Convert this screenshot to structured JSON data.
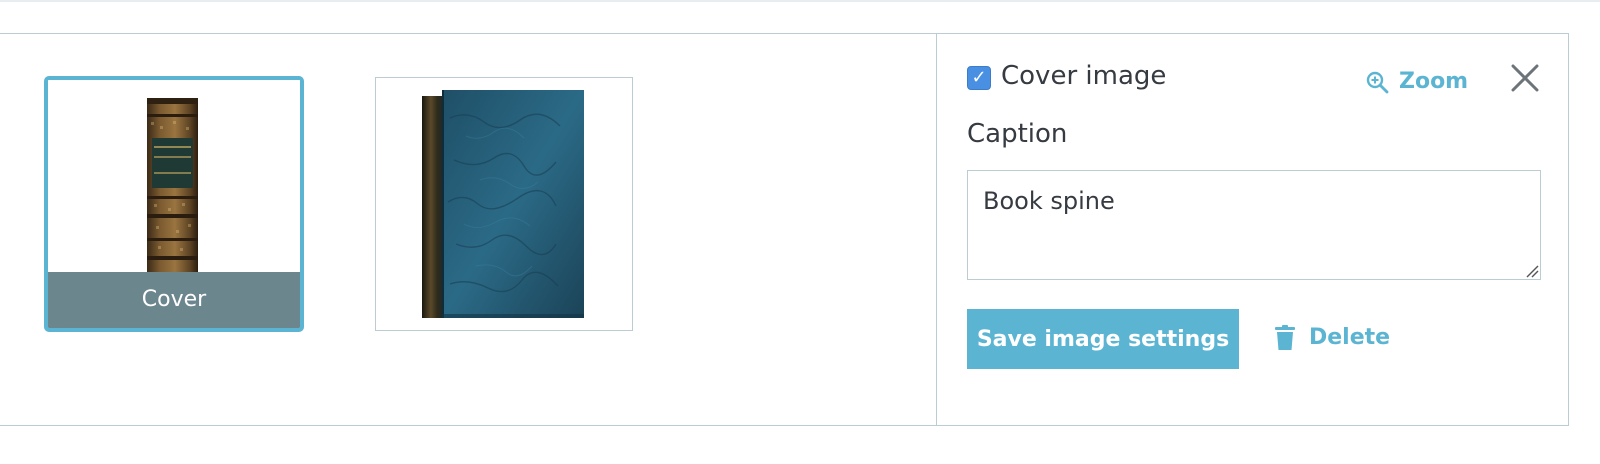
{
  "thumbnails": [
    {
      "label": "Cover",
      "selected": true,
      "image": "book-spine-image"
    },
    {
      "label": "",
      "selected": false,
      "image": "blue-book-image"
    }
  ],
  "settings": {
    "cover_image_label": "Cover image",
    "cover_image_checked": true,
    "zoom_label": "Zoom",
    "zoom_icon": "zoom-in-icon",
    "close_icon": "close-icon",
    "caption_label": "Caption",
    "caption_value": "Book spine",
    "save_label": "Save image settings",
    "delete_label": "Delete",
    "delete_icon": "trash-icon"
  },
  "colors": {
    "accent": "#5bb5d2",
    "cover_label_bg": "#6c868e",
    "checkbox": "#4a90e2",
    "border": "#bbcdd2"
  }
}
